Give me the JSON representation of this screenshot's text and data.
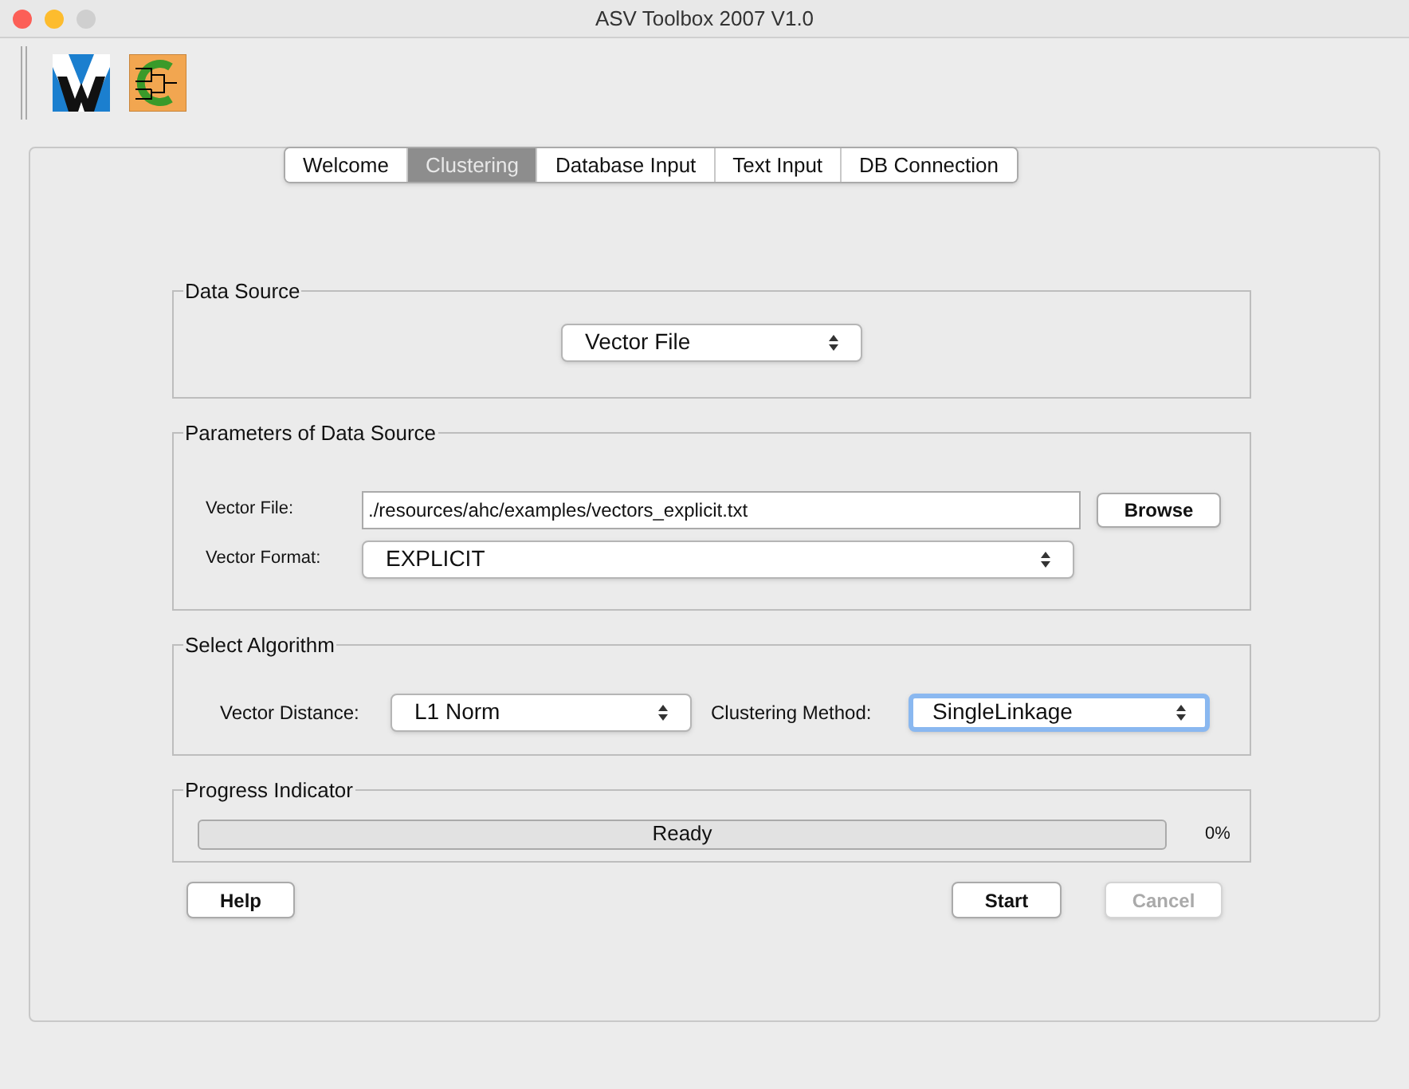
{
  "window": {
    "title": "ASV Toolbox 2007 V1.0"
  },
  "tabs": [
    {
      "label": "Welcome",
      "selected": false
    },
    {
      "label": "Clustering",
      "selected": true
    },
    {
      "label": "Database Input",
      "selected": false
    },
    {
      "label": "Text Input",
      "selected": false
    },
    {
      "label": "DB Connection",
      "selected": false
    }
  ],
  "data_source": {
    "title": "Data Source",
    "value": "Vector File"
  },
  "parameters": {
    "title": "Parameters of Data Source",
    "vector_file_label": "Vector File:",
    "vector_file_value": "./resources/ahc/examples/vectors_explicit.txt",
    "browse": "Browse",
    "vector_format_label": "Vector Format:",
    "vector_format_value": "EXPLICIT"
  },
  "algorithm": {
    "title": "Select Algorithm",
    "distance_label": "Vector Distance:",
    "distance_value": "L1 Norm",
    "method_label": "Clustering Method:",
    "method_value": "SingleLinkage",
    "method_focused": true
  },
  "progress": {
    "title": "Progress Indicator",
    "text": "Ready",
    "level": 0,
    "reading": "0%"
  },
  "buttons": [
    {
      "label": "Help",
      "disabled": false
    },
    {
      "label": "Start",
      "disabled": false
    },
    {
      "label": "Cancel",
      "disabled": true
    }
  ]
}
